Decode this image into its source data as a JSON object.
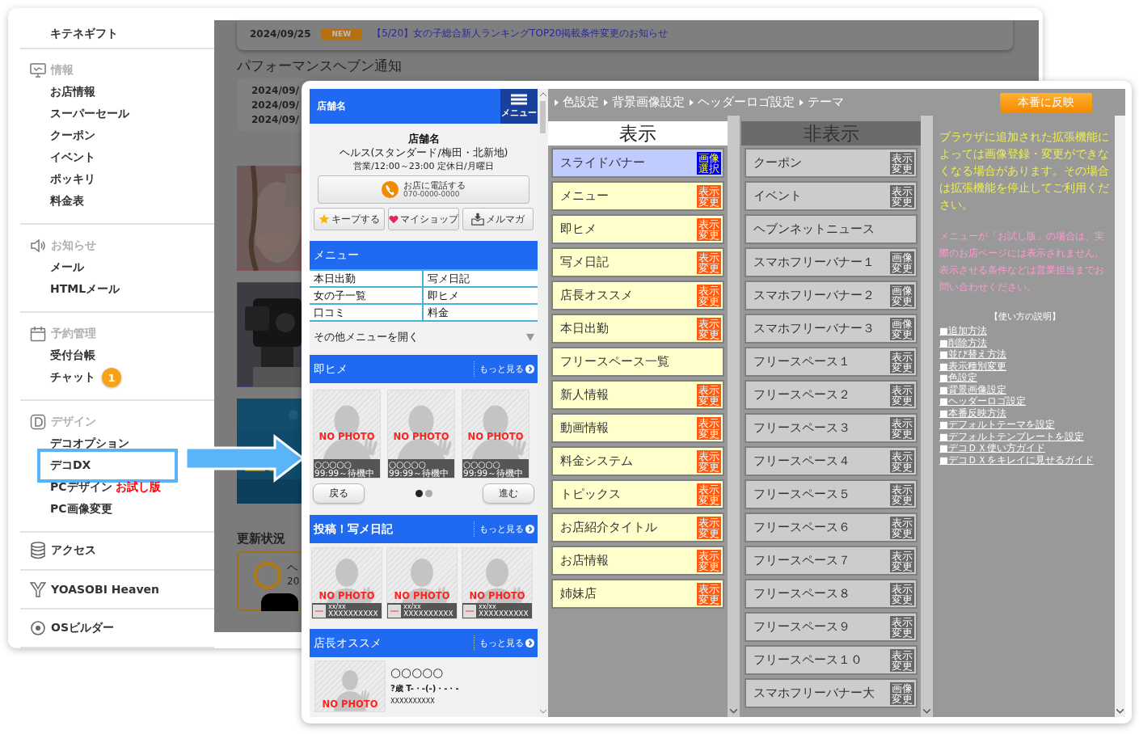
{
  "sidebar": {
    "top_item": "キテネギフト",
    "sections": [
      {
        "kind": "group",
        "title": "情報",
        "items": [
          {
            "label": "お店情報",
            "highlighted": false
          },
          {
            "label": "スーパーセール",
            "highlighted": false
          },
          {
            "label": "クーポン",
            "highlighted": false
          },
          {
            "label": "イベント",
            "highlighted": false
          },
          {
            "label": "ポッキリ",
            "highlighted": false
          },
          {
            "label": "料金表",
            "highlighted": false
          }
        ]
      },
      {
        "kind": "group",
        "title": "お知らせ",
        "items": [
          {
            "label": "メール",
            "highlighted": false
          },
          {
            "label": "HTMLメール",
            "highlighted": false
          }
        ]
      },
      {
        "kind": "group",
        "title": "予約管理",
        "items": [
          {
            "label": "受付台帳",
            "highlighted": false
          },
          {
            "label": "チャット",
            "badge": "1",
            "highlighted": false
          }
        ]
      },
      {
        "kind": "group",
        "title": "デザイン",
        "items": [
          {
            "label": "デコオプション",
            "highlighted": false
          },
          {
            "label": "デコDX",
            "highlighted": true
          },
          {
            "label": "PCデザイン",
            "tag": "お試し版",
            "highlighted": false
          },
          {
            "label": "PC画像変更",
            "highlighted": false
          }
        ]
      },
      {
        "kind": "link",
        "title": "アクセス"
      },
      {
        "kind": "link",
        "title": "YOASOBI Heaven"
      },
      {
        "kind": "link",
        "title": "OSビルダー"
      }
    ]
  },
  "background_page": {
    "news": [
      {
        "date": "2024/09/25",
        "tag": "NEW",
        "title": "【5/20】女の子総合新人ランキングTOP20掲載条件変更のお知らせ"
      }
    ],
    "notice_title": "パフォーマンスヘブン通知",
    "notice_dates": [
      "2024/09/",
      "2024/09/",
      "2024/09/"
    ],
    "updates_title": "更新状況",
    "update_card": {
      "title": "ヘ",
      "date": "20"
    }
  },
  "preview": {
    "header_title": "店舗名",
    "menu_button": "メニュー",
    "shop": {
      "name": "店舗名",
      "category": "ヘルス(スタンダード/梅田・北新地)",
      "hours": "営業/12:00～23:00 定休日/月曜日"
    },
    "call": {
      "label": "お店に電話する",
      "phone": "070-0000-0000"
    },
    "actions": [
      {
        "label": "キープする"
      },
      {
        "label": "マイショップ"
      },
      {
        "label": "メルマガ"
      }
    ],
    "menu": {
      "title": "メニュー",
      "links": [
        "本日出勤",
        "写メ日記",
        "女の子一覧",
        "即ヒメ",
        "口コミ",
        "料金"
      ],
      "more": "その他メニューを開く"
    },
    "sections": [
      {
        "kind": "slider",
        "title": "即ヒメ",
        "more": "もっと見る",
        "back": "戻る",
        "next": "進む",
        "dots": [
          {
            "selected": true
          },
          {
            "selected": false
          }
        ],
        "cards": [
          {
            "photo_label": "NO PHOTO",
            "line1": "○○○○○",
            "line2": "99:99～待機中"
          },
          {
            "photo_label": "NO PHOTO",
            "line1": "○○○○○",
            "line2": "99:99～待機中"
          },
          {
            "photo_label": "NO PHOTO",
            "line1": "○○○○○",
            "line2": "99:99～待機中"
          }
        ]
      },
      {
        "kind": "diary",
        "title": "投稿！写メ日記",
        "more": "もっと見る",
        "cards": [
          {
            "photo_label": "NO PHOTO",
            "line1": "xx/xx",
            "line2": "XXXXXXXXXX"
          },
          {
            "photo_label": "NO PHOTO",
            "line1": "xx/xx",
            "line2": "XXXXXXXXXX"
          },
          {
            "photo_label": "NO PHOTO",
            "line1": "xx/xx",
            "line2": "XXXXXXXXXX"
          }
        ]
      },
      {
        "kind": "pick",
        "title": "店長オススメ",
        "more": "もっと見る",
        "photo_label": "NO PHOTO",
        "name": "○○○○○",
        "profile": "?歳 T-・-(-)・-・-",
        "text": "XXXXXXXXXX"
      }
    ]
  },
  "settings": {
    "breadcrumbs": [
      "色設定",
      "背景画像設定",
      "ヘッダーロゴ設定",
      "テーマ"
    ],
    "publish_button": "本番に反映",
    "columns": [
      {
        "kind": "shown",
        "title": "表示",
        "items": [
          {
            "label": "スライドバナー",
            "selected": true,
            "badge": "画像選択",
            "kind": "select"
          },
          {
            "label": "メニュー",
            "selected": false,
            "badge": "表示変更",
            "kind": "toggle"
          },
          {
            "label": "即ヒメ",
            "selected": false,
            "badge": "表示変更",
            "kind": "toggle"
          },
          {
            "label": "写メ日記",
            "selected": false,
            "badge": "表示変更",
            "kind": "toggle"
          },
          {
            "label": "店長オススメ",
            "selected": false,
            "badge": "表示変更",
            "kind": "toggle"
          },
          {
            "label": "本日出勤",
            "selected": false,
            "badge": "表示変更",
            "kind": "toggle"
          },
          {
            "label": "フリースペース一覧",
            "selected": false
          },
          {
            "label": "新人情報",
            "selected": false,
            "badge": "表示変更",
            "kind": "toggle"
          },
          {
            "label": "動画情報",
            "selected": false,
            "badge": "表示変更",
            "kind": "toggle"
          },
          {
            "label": "料金システム",
            "selected": false,
            "badge": "表示変更",
            "kind": "toggle"
          },
          {
            "label": "トピックス",
            "selected": false,
            "badge": "表示変更",
            "kind": "toggle"
          },
          {
            "label": "お店紹介タイトル",
            "selected": false,
            "badge": "表示変更",
            "kind": "toggle"
          },
          {
            "label": "お店情報",
            "selected": false,
            "badge": "表示変更",
            "kind": "toggle"
          },
          {
            "label": "姉妹店",
            "selected": false,
            "badge": "表示変更",
            "kind": "toggle"
          }
        ]
      },
      {
        "kind": "hidden",
        "title": "非表示",
        "items": [
          {
            "label": "クーポン",
            "selected": false,
            "badge": "表示変更",
            "kind": "toggle"
          },
          {
            "label": "イベント",
            "selected": false,
            "badge": "表示変更",
            "kind": "toggle"
          },
          {
            "label": "ヘブンネットニュース",
            "selected": false
          },
          {
            "label": "スマホフリーバナー１",
            "selected": false,
            "badge": "画像変更"
          },
          {
            "label": "スマホフリーバナー２",
            "selected": false,
            "badge": "画像変更"
          },
          {
            "label": "スマホフリーバナー３",
            "selected": false,
            "badge": "画像変更"
          },
          {
            "label": "フリースペース１",
            "selected": false,
            "badge": "表示変更",
            "kind": "toggle"
          },
          {
            "label": "フリースペース２",
            "selected": false,
            "badge": "表示変更",
            "kind": "toggle"
          },
          {
            "label": "フリースペース３",
            "selected": false,
            "badge": "表示変更",
            "kind": "toggle"
          },
          {
            "label": "フリースペース４",
            "selected": false,
            "badge": "表示変更",
            "kind": "toggle"
          },
          {
            "label": "フリースペース５",
            "selected": false,
            "badge": "表示変更",
            "kind": "toggle"
          },
          {
            "label": "フリースペース６",
            "selected": false,
            "badge": "表示変更",
            "kind": "toggle"
          },
          {
            "label": "フリースペース７",
            "selected": false,
            "badge": "表示変更",
            "kind": "toggle"
          },
          {
            "label": "フリースペース８",
            "selected": false,
            "badge": "表示変更",
            "kind": "toggle"
          },
          {
            "label": "フリースペース９",
            "selected": false,
            "badge": "表示変更",
            "kind": "toggle"
          },
          {
            "label": "フリースペース１０",
            "selected": false,
            "badge": "表示変更",
            "kind": "toggle"
          },
          {
            "label": "スマホフリーバナー大",
            "selected": false,
            "badge": "画像変更"
          }
        ]
      }
    ],
    "notes": [
      {
        "kind": "warning",
        "text": "ブラウザに追加された拡張機能によっては画像登録・変更ができなくなる場合があります。その場合は拡張機能を停止してご利用ください。"
      },
      {
        "kind": "trial",
        "text": "メニューが「お試し版」の場合は、実際のお店ページには表示されません。表示させる条件などは営業担当までお問い合わせください。"
      }
    ],
    "help_title": "【使い方の説明】",
    "help_links": [
      "■追加方法",
      "■削除方法",
      "■並び替え方法",
      "■表示種別変更",
      "■色設定",
      "■背景画像設定",
      "■ヘッダーロゴ設定",
      "■本番反映方法",
      "■デフォルトテーマを設定",
      "■デフォルトテンプレートを設定",
      "■デコＤＸ使い方ガイド",
      "■デコＤＸをキレイに見せるガイド"
    ]
  }
}
